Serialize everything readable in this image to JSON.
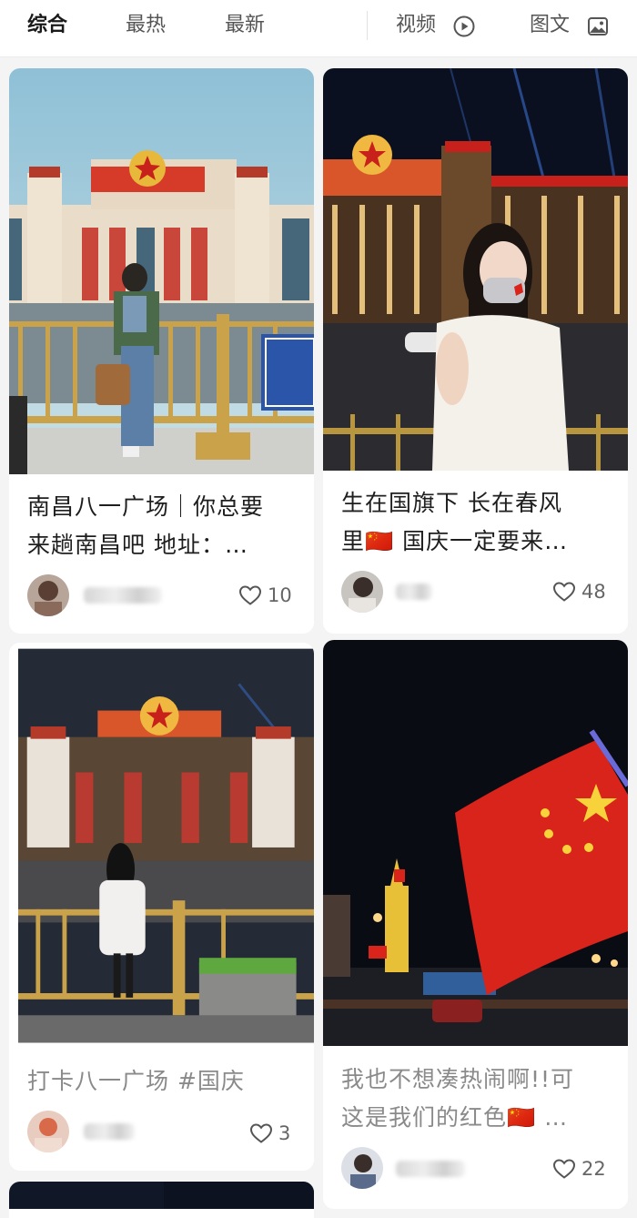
{
  "tabs": {
    "all": "综合",
    "hot": "最热",
    "latest": "最新",
    "video": "视频",
    "image_text": "图文"
  },
  "icons": {
    "video": "play-circle-icon",
    "image_text": "image-icon",
    "like": "heart-outline-icon"
  },
  "feed": [
    {
      "title_line1": "南昌八一广场｜你总要",
      "title_line2": "来趟南昌吧 地址：…",
      "likes": "10"
    },
    {
      "title_line1": "生在国旗下 长在春风",
      "title_line2": "里🇨🇳 国庆一定要来…",
      "likes": "48"
    },
    {
      "title_line1": "打卡八一广场 #国庆",
      "title_line2": "",
      "likes": "3"
    },
    {
      "title_line1": "我也不想凑热闹啊!!可",
      "title_line2": "这是我们的红色🇨🇳 …",
      "likes": "22"
    }
  ],
  "colors": {
    "active_tab": "#1a1a1a",
    "inactive_tab": "#555555",
    "flag_red": "#d8241b",
    "star_yellow": "#f7d23a"
  }
}
